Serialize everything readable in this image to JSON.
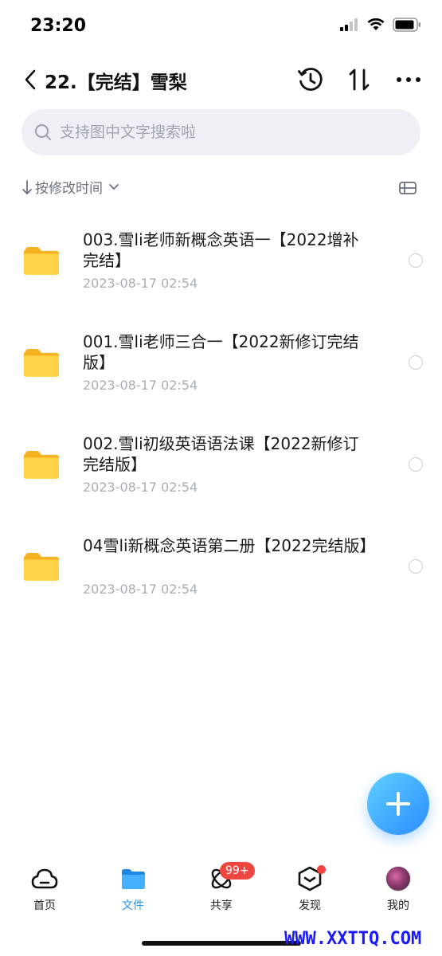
{
  "status": {
    "time": "23:20"
  },
  "header": {
    "title": "22.【完结】雪梨"
  },
  "search": {
    "placeholder": "支持图中文字搜索啦"
  },
  "sort": {
    "label": "按修改时间"
  },
  "files": [
    {
      "name": "003.雪li老师新概念英语一【2022增补完结】",
      "date": "2023-08-17 02:54"
    },
    {
      "name": "001.雪li老师三合一【2022新修订完结版】",
      "date": "2023-08-17 02:54"
    },
    {
      "name": "002.雪li初级英语语法课【2022新修订完结版】",
      "date": "2023-08-17 02:54"
    },
    {
      "name": "04雪li新概念英语第二册【2022完结版】",
      "date": "2023-08-17 02:54"
    }
  ],
  "tabs": [
    {
      "label": "首页"
    },
    {
      "label": "文件"
    },
    {
      "label": "共享",
      "badge": "99+"
    },
    {
      "label": "发现"
    },
    {
      "label": "我的"
    }
  ],
  "watermark": "WWW.XXTTQ.COM",
  "colors": {
    "accent": "#2196f3",
    "folder": "#ffc83d",
    "badge": "#f0453f"
  }
}
